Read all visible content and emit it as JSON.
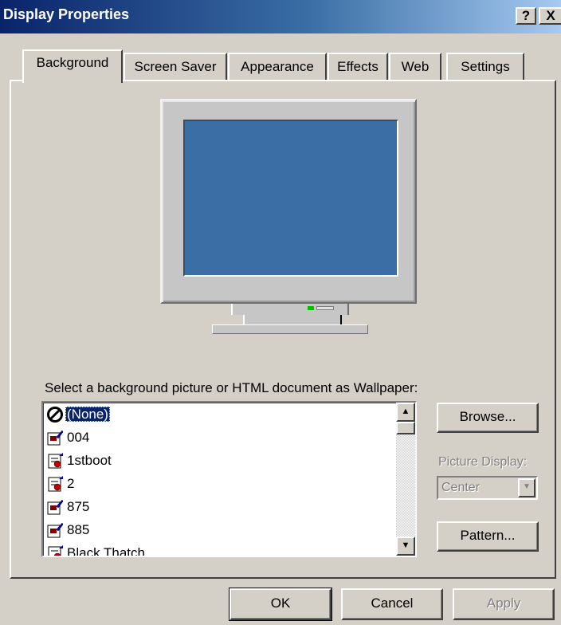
{
  "window": {
    "title": "Display Properties",
    "help_label": "?",
    "close_label": "X"
  },
  "tabs": [
    {
      "label": "Background",
      "active": true
    },
    {
      "label": "Screen Saver",
      "active": false
    },
    {
      "label": "Appearance",
      "active": false
    },
    {
      "label": "Effects",
      "active": false
    },
    {
      "label": "Web",
      "active": false
    },
    {
      "label": "Settings",
      "active": false
    }
  ],
  "background": {
    "wallpaper_label": "Select a background picture or HTML document as Wallpaper:",
    "list_items": [
      {
        "label": "(None)",
        "icon": "none-icon",
        "selected": true
      },
      {
        "label": "004",
        "icon": "bitmap-icon",
        "selected": false
      },
      {
        "label": "1stboot",
        "icon": "html-doc-icon",
        "selected": false
      },
      {
        "label": "2",
        "icon": "html-doc-icon",
        "selected": false
      },
      {
        "label": "875",
        "icon": "bitmap-icon",
        "selected": false
      },
      {
        "label": "885",
        "icon": "bitmap-icon",
        "selected": false
      },
      {
        "label": "Black Thatch",
        "icon": "html-doc-icon",
        "selected": false
      }
    ],
    "browse_label": "Browse...",
    "picture_display_label": "Picture Display:",
    "picture_display_value": "Center",
    "pattern_label": "Pattern..."
  },
  "footer": {
    "ok_label": "OK",
    "cancel_label": "Cancel",
    "apply_label": "Apply"
  },
  "colors": {
    "desktop_blue": "#3a6ea5",
    "title_start": "#0a246a",
    "face": "#d4d0c8"
  }
}
